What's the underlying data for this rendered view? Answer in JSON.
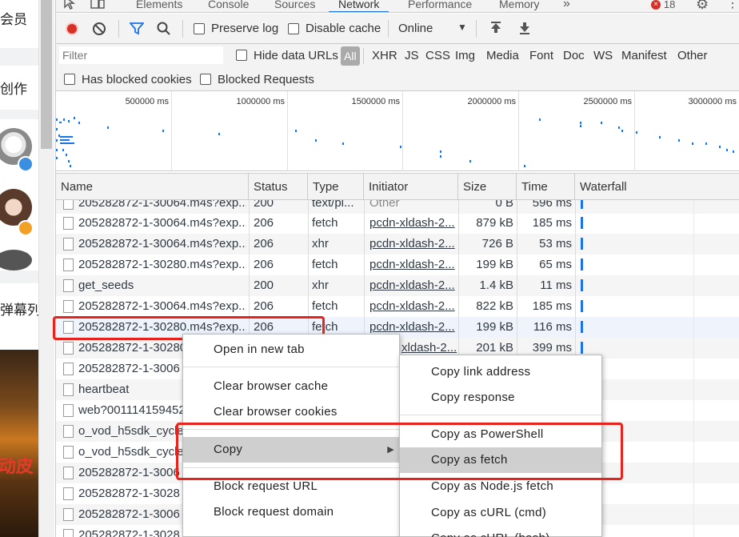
{
  "left_page": {
    "texts": [
      "会员",
      "创作",
      "弹幕列"
    ],
    "banner_text": "动皮"
  },
  "devtools": {
    "tabs": [
      "Elements",
      "Console",
      "Sources",
      "Network",
      "Performance",
      "Memory"
    ],
    "more_tabs": "»",
    "error_count": "18",
    "toolbar": {
      "preserve_log": "Preserve log",
      "disable_cache": "Disable cache",
      "throttling": "Online"
    },
    "filter": {
      "placeholder": "Filter",
      "hide_data_urls": "Hide data URLs",
      "types": [
        "All",
        "XHR",
        "JS",
        "CSS",
        "Img",
        "Media",
        "Font",
        "Doc",
        "WS",
        "Manifest",
        "Other"
      ],
      "has_blocked_cookies": "Has blocked cookies",
      "blocked_requests": "Blocked Requests"
    },
    "overview_ticks": [
      "500000 ms",
      "1000000 ms",
      "1500000 ms",
      "2000000 ms",
      "2500000 ms",
      "3000000 ms"
    ],
    "columns": [
      "Name",
      "Status",
      "Type",
      "Initiator",
      "Size",
      "Time",
      "Waterfall"
    ],
    "rows": [
      {
        "name": "205282872-1-30064.m4s?exp...",
        "status": "200",
        "type": "text/pl...",
        "initiator": "Other",
        "size": "0 B",
        "time": "596 ms"
      },
      {
        "name": "205282872-1-30064.m4s?exp...",
        "status": "206",
        "type": "fetch",
        "initiator": "pcdn-xldash-2...",
        "size": "879 kB",
        "time": "185 ms"
      },
      {
        "name": "205282872-1-30064.m4s?exp...",
        "status": "206",
        "type": "xhr",
        "initiator": "pcdn-xldash-2...",
        "size": "726 B",
        "time": "53 ms"
      },
      {
        "name": "205282872-1-30280.m4s?exp...",
        "status": "206",
        "type": "fetch",
        "initiator": "pcdn-xldash-2...",
        "size": "199 kB",
        "time": "65 ms"
      },
      {
        "name": "get_seeds",
        "status": "200",
        "type": "xhr",
        "initiator": "pcdn-xldash-2...",
        "size": "1.4 kB",
        "time": "11 ms"
      },
      {
        "name": "205282872-1-30064.m4s?exp...",
        "status": "206",
        "type": "fetch",
        "initiator": "pcdn-xldash-2...",
        "size": "822 kB",
        "time": "185 ms"
      },
      {
        "name": "205282872-1-30280.m4s?exp...",
        "status": "206",
        "type": "fetch",
        "initiator": "pcdn-xldash-2...",
        "size": "199 kB",
        "time": "116 ms"
      },
      {
        "name": "205282872-1-30280",
        "status": "",
        "type": "",
        "initiator": "xldash-2...",
        "size": "201 kB",
        "time": "399 ms"
      },
      {
        "name": "205282872-1-3006",
        "status": "",
        "type": "",
        "initiator": "",
        "size": "",
        "time": ""
      },
      {
        "name": "heartbeat",
        "status": "",
        "type": "",
        "initiator": "",
        "size": "",
        "time": ""
      },
      {
        "name": "web?001114159452",
        "status": "",
        "type": "",
        "initiator": "",
        "size": "",
        "time": ""
      },
      {
        "name": "o_vod_h5sdk_cycle",
        "status": "",
        "type": "",
        "initiator": "",
        "size": "",
        "time": ""
      },
      {
        "name": "o_vod_h5sdk_cycle",
        "status": "",
        "type": "",
        "initiator": "",
        "size": "",
        "time": ""
      },
      {
        "name": "205282872-1-3006",
        "status": "",
        "type": "",
        "initiator": "",
        "size": "",
        "time": ""
      },
      {
        "name": "205282872-1-3028",
        "status": "",
        "type": "",
        "initiator": "",
        "size": "",
        "time": ""
      },
      {
        "name": "205282872-1-3006",
        "status": "",
        "type": "",
        "initiator": "",
        "size": "",
        "time": ""
      },
      {
        "name": "205282872-1-3028",
        "status": "",
        "type": "",
        "initiator": "",
        "size": "",
        "time": ""
      }
    ],
    "context_menu": {
      "items": [
        "Open in new tab",
        "Clear browser cache",
        "Clear browser cookies",
        "Copy",
        "Block request URL",
        "Block request domain"
      ]
    },
    "copy_submenu": {
      "items": [
        "Copy link address",
        "Copy response",
        "Copy as PowerShell",
        "Copy as fetch",
        "Copy as Node.js fetch",
        "Copy as cURL (cmd)",
        "Copy as cURL (bash)"
      ]
    }
  },
  "colors": {
    "record_red": "#d93025",
    "accent_blue": "#1a73e8",
    "annotation_red": "#e8231d"
  }
}
